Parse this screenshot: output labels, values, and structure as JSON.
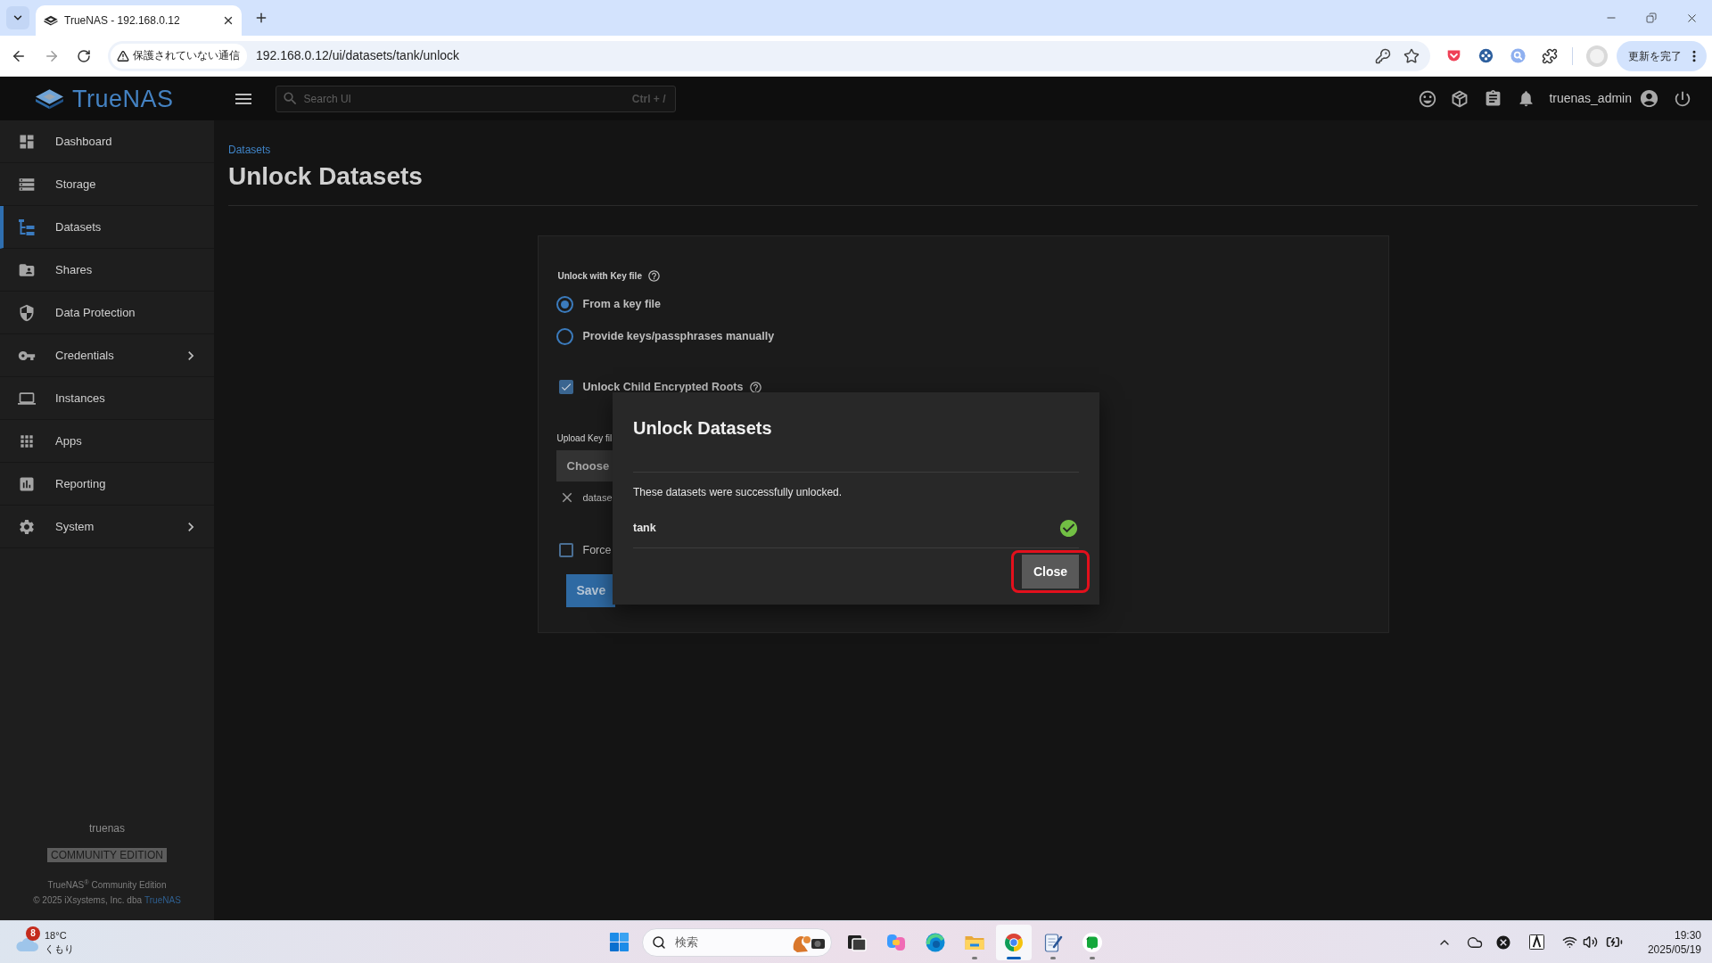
{
  "browser": {
    "tabs": [
      {
        "title": "TrueNAS - 192.168.0.12",
        "selected": true
      }
    ],
    "security_chip": "保護されていない通信",
    "url": "192.168.0.12/ui/datasets/tank/unlock",
    "update_button": "更新を完了"
  },
  "topbar": {
    "logo": "TrueNAS",
    "search": {
      "placeholder": "Search UI",
      "shortcut": "Ctrl + /"
    },
    "username": "truenas_admin"
  },
  "sidebar": {
    "items": [
      {
        "label": "Dashboard",
        "selected": false,
        "has_submenu": false
      },
      {
        "label": "Storage",
        "selected": false,
        "has_submenu": false
      },
      {
        "label": "Datasets",
        "selected": true,
        "has_submenu": false
      },
      {
        "label": "Shares",
        "selected": false,
        "has_submenu": false
      },
      {
        "label": "Data Protection",
        "selected": false,
        "has_submenu": false
      },
      {
        "label": "Credentials",
        "selected": false,
        "has_submenu": true
      },
      {
        "label": "Instances",
        "selected": false,
        "has_submenu": false
      },
      {
        "label": "Apps",
        "selected": false,
        "has_submenu": false
      },
      {
        "label": "Reporting",
        "selected": false,
        "has_submenu": false
      },
      {
        "label": "System",
        "selected": false,
        "has_submenu": true
      }
    ],
    "footer": {
      "hostname": "truenas",
      "edition_badge": "COMMUNITY EDITION",
      "product": "TrueNAS$^{®}$ Community Edition",
      "copyright": "© 2025 iXsystems, Inc. dba",
      "copyright_link": "TrueNAS"
    }
  },
  "page": {
    "breadcrumb": "Datasets",
    "title": "Unlock Datasets"
  },
  "form": {
    "section_label": "Unlock with Key file",
    "radios": [
      {
        "label": "From a key file",
        "selected": true
      },
      {
        "label": "Provide keys/passphrases manually",
        "selected": false
      }
    ],
    "unlock_children": {
      "label": "Unlock Child Encrypted Roots",
      "checked": true
    },
    "upload_label": "Upload Key fil",
    "choose_button": "Choose",
    "file_name": "datase",
    "force": {
      "label": "Force",
      "checked": false
    },
    "save_button": "Save"
  },
  "dialog": {
    "title": "Unlock Datasets",
    "message": "These datasets were successfully unlocked.",
    "datasets": [
      {
        "name": "tank",
        "unlocked": true
      }
    ],
    "close_button": "Close",
    "close_highlighted": true
  },
  "taskbar": {
    "weather": {
      "badge": "8",
      "temperature": "18°C",
      "condition": "くもり"
    },
    "search_placeholder": "検索",
    "apps": [
      {
        "running": false,
        "selected": false
      },
      {
        "running": false,
        "selected": false
      },
      {
        "running": false,
        "selected": false
      },
      {
        "running": true,
        "selected": false
      },
      {
        "running": true,
        "selected": true
      },
      {
        "running": true,
        "selected": false
      },
      {
        "running": true,
        "selected": false
      }
    ],
    "clock": {
      "time": "19:30",
      "date": "2025/05/19"
    }
  }
}
